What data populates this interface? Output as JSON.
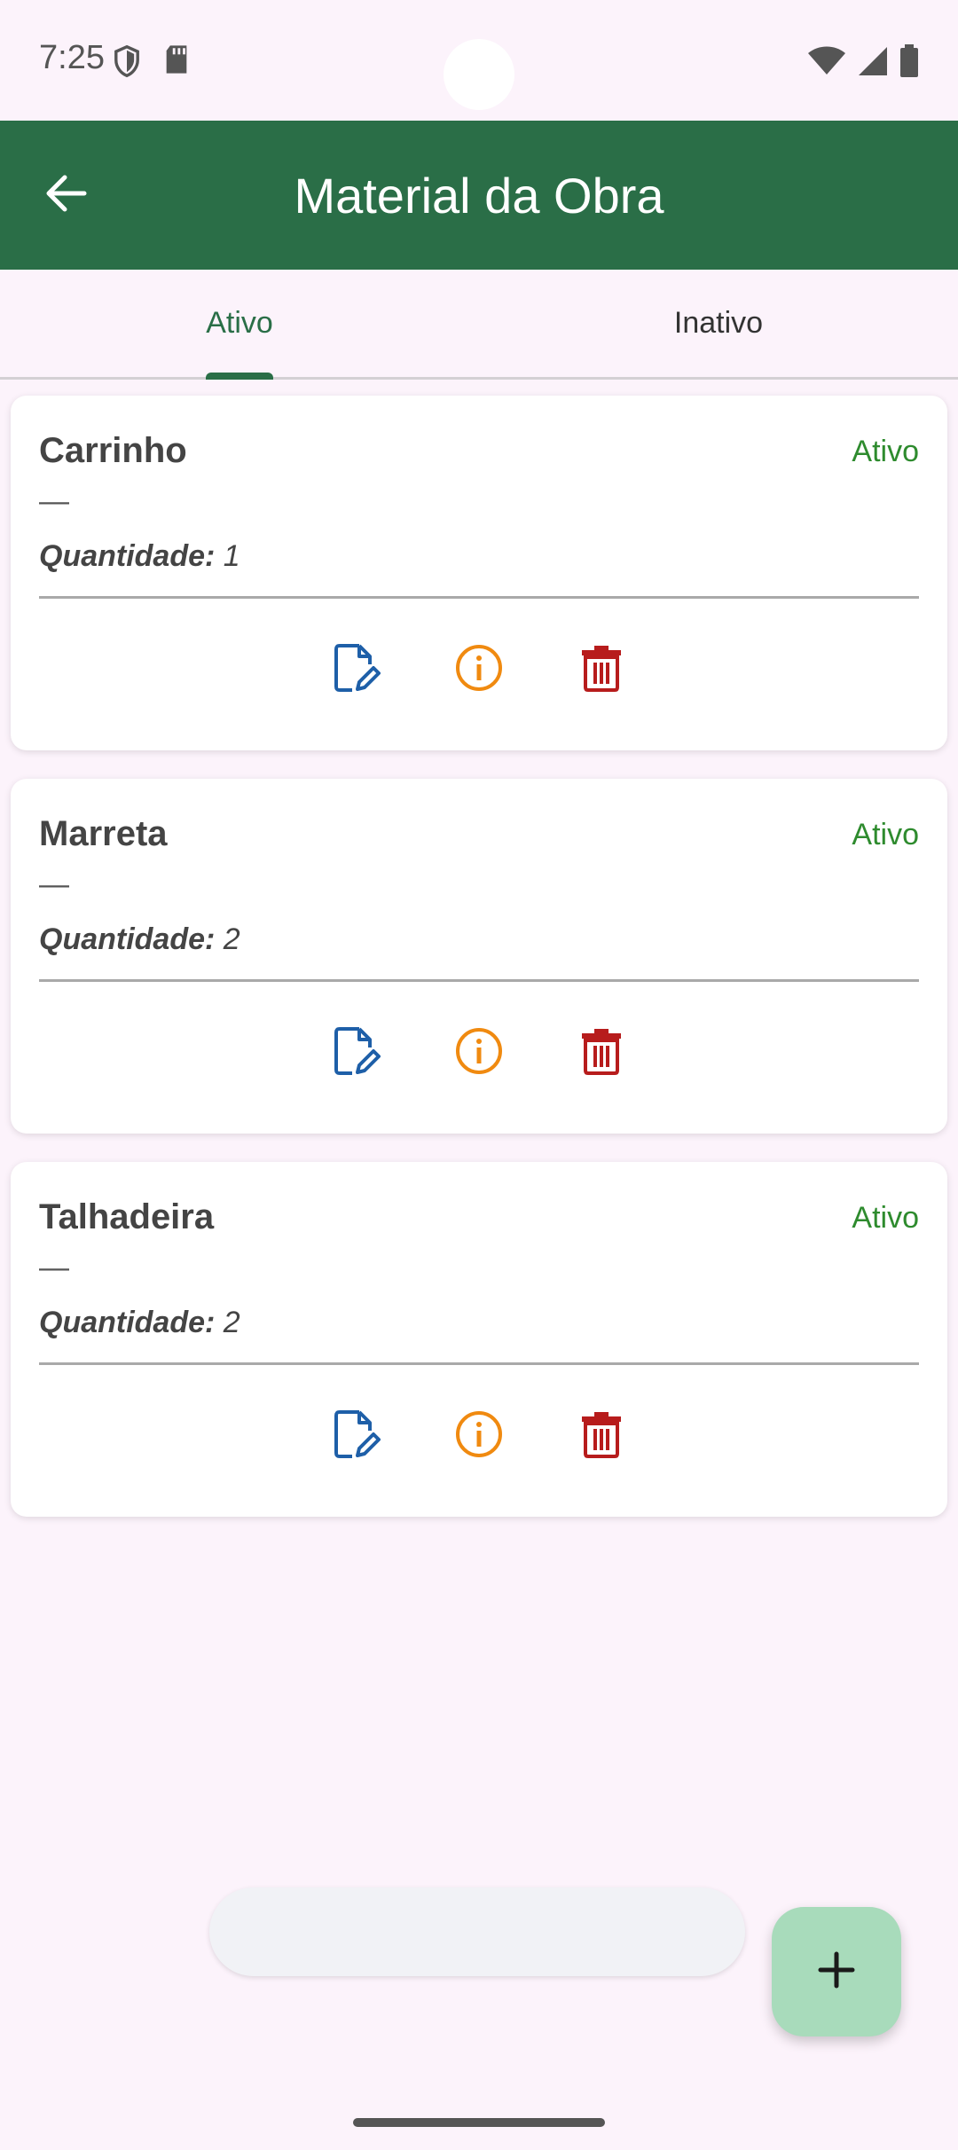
{
  "status_bar": {
    "time": "7:25",
    "icons": [
      "shield-icon",
      "sd-card-icon",
      "wifi-icon",
      "signal-icon",
      "battery-icon"
    ]
  },
  "app_bar": {
    "title": "Material da Obra",
    "back_icon": "arrow-left-icon",
    "background": "#2a6e47"
  },
  "tabs": [
    {
      "label": "Ativo",
      "active": true
    },
    {
      "label": "Inativo",
      "active": false
    }
  ],
  "cards": [
    {
      "title": "Carrinho",
      "status": "Ativo",
      "dash": "—",
      "qty_label": "Quantidade:",
      "qty_value": "1"
    },
    {
      "title": "Marreta",
      "status": "Ativo",
      "dash": "—",
      "qty_label": "Quantidade:",
      "qty_value": "2"
    },
    {
      "title": "Talhadeira",
      "status": "Ativo",
      "dash": "—",
      "qty_label": "Quantidade:",
      "qty_value": "2"
    }
  ],
  "actions": {
    "edit_icon": "edit-document-icon",
    "info_icon": "info-icon",
    "delete_icon": "trash-icon",
    "edit_color": "#1e5fa8",
    "info_color": "#f08a10",
    "delete_color": "#b71c1c"
  },
  "fab": {
    "icon": "plus-icon",
    "background": "#a8dbbb"
  },
  "colors": {
    "status_active": "#2e8b2e",
    "page_bg": "#fcf3fb"
  }
}
